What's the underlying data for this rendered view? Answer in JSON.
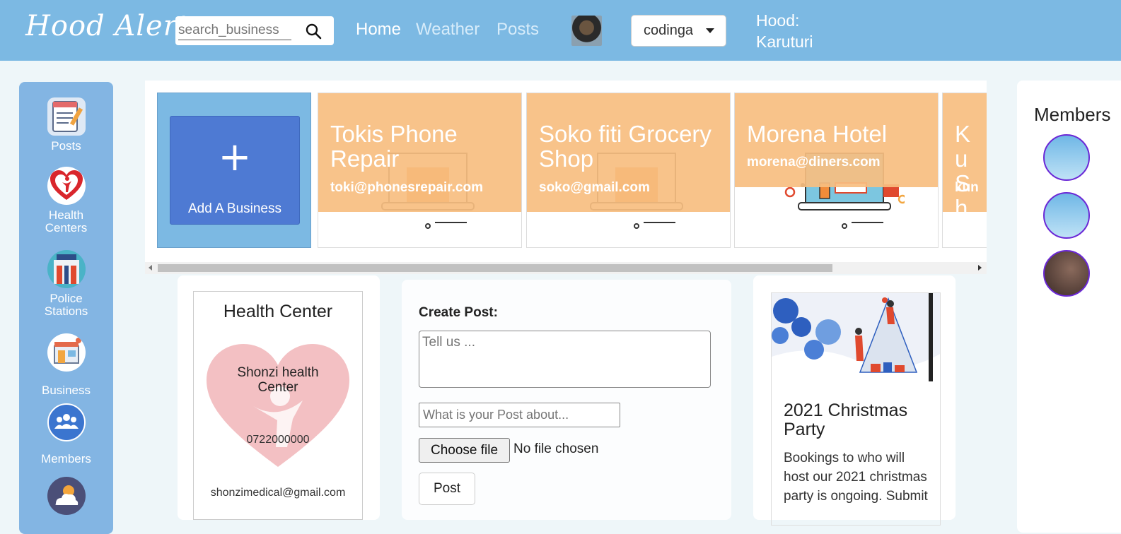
{
  "header": {
    "brand": "Hood Alert",
    "search_placeholder": "search_business",
    "nav": [
      "Home",
      "Weather",
      "Posts"
    ],
    "user": "codinga",
    "hood_label": "Hood:",
    "hood_name": "Karuturi"
  },
  "sidebar": {
    "items": [
      {
        "label": "Posts",
        "icon": "posts-icon"
      },
      {
        "label": "Health Centers",
        "icon": "health-icon"
      },
      {
        "label": "Police Stations",
        "icon": "police-icon"
      },
      {
        "label": "Business",
        "icon": "business-icon"
      },
      {
        "label": "Members",
        "icon": "members-icon"
      },
      {
        "label": "",
        "icon": "weather-icon"
      }
    ]
  },
  "businesses": {
    "add_label": "Add A Business",
    "add_plus": "+",
    "items": [
      {
        "name": "Tokis Phone Repair",
        "email": "toki@phonesrepair.com"
      },
      {
        "name": "Soko fiti Grocery Shop",
        "email": "soko@gmail.com"
      },
      {
        "name": "Morena Hotel",
        "email": "morena@diners.com"
      },
      {
        "name": "Ku Sh",
        "email": "kun"
      }
    ]
  },
  "members": {
    "title": "Members",
    "count_shown": 3
  },
  "health_center": {
    "title": "Health Center",
    "name": "Shonzi health Center",
    "phone": "0722000000",
    "email": "shonzimedical@gmail.com"
  },
  "create_post": {
    "label": "Create Post:",
    "text_placeholder": "Tell us ...",
    "about_placeholder": "What is your Post about...",
    "file_button": "Choose file",
    "file_status": "No file chosen",
    "submit": "Post"
  },
  "event": {
    "title": "2021 Christmas Party",
    "description": "Bookings to who will host our 2021 christmas party is ongoing. Submit"
  },
  "colors": {
    "navbar": "#7cb9e3",
    "sidebar": "#83b5e3",
    "add_button": "#4e7ad3",
    "business_overlay": "#f7be80",
    "member_ring": "#6b28d6"
  }
}
